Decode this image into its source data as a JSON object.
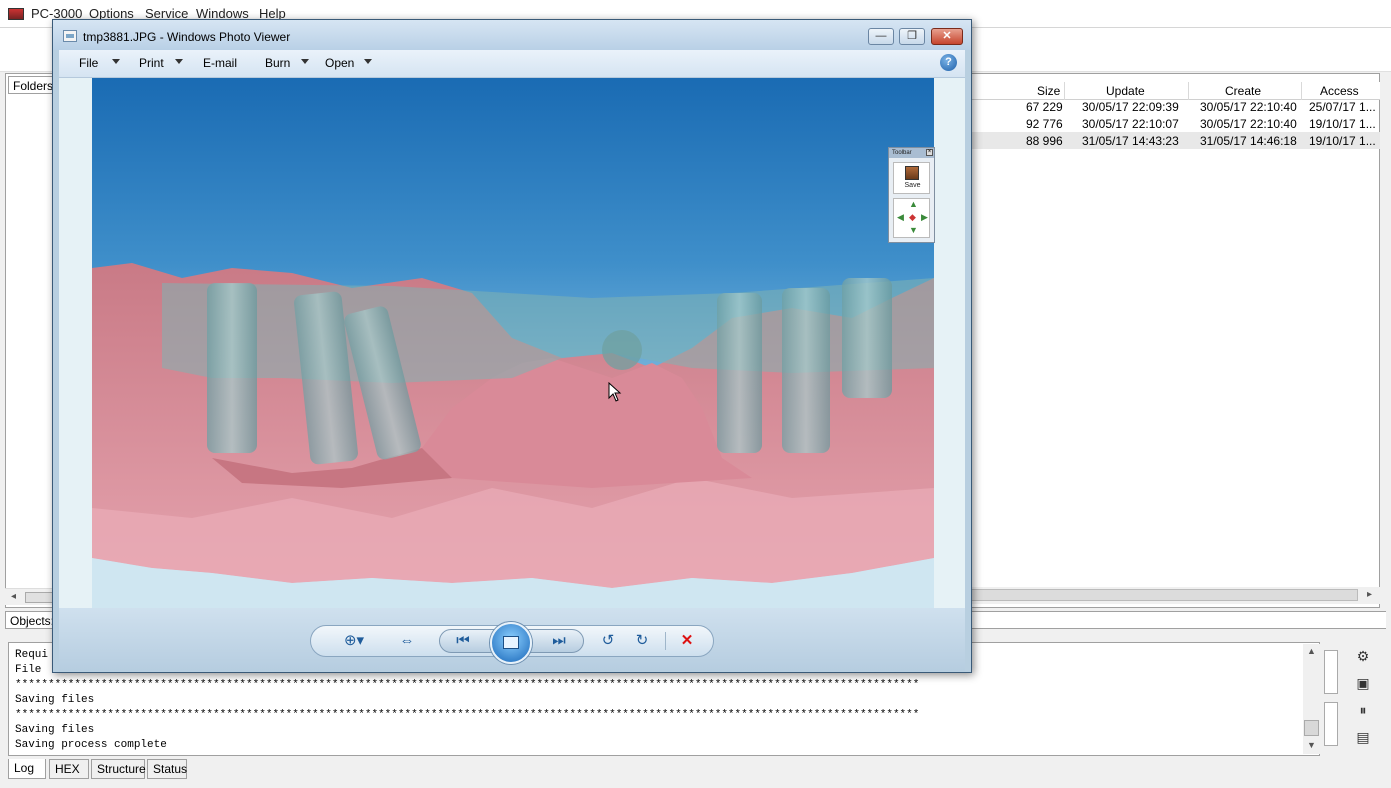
{
  "app": {
    "title": "PC-3000",
    "menu": [
      "PC-3000",
      "Options",
      "Service",
      "Windows",
      "Help"
    ]
  },
  "folders_tab": "Folders",
  "objects_label": "Objects:",
  "files": {
    "headers": {
      "size": "Size",
      "update": "Update",
      "create": "Create",
      "access": "Access"
    },
    "rows": [
      {
        "size": "67 229",
        "update": "30/05/17 22:09:39",
        "create": "30/05/17 22:10:40",
        "access": "25/07/17 1...",
        "selected": false
      },
      {
        "size": "92 776",
        "update": "30/05/17 22:10:07",
        "create": "30/05/17 22:10:40",
        "access": "19/10/17 1...",
        "selected": false
      },
      {
        "size": "88 996",
        "update": "31/05/17 14:43:23",
        "create": "31/05/17 14:46:18",
        "access": "19/10/17 1...",
        "selected": true
      }
    ]
  },
  "log": {
    "lines": [
      "Requi",
      "File ",
      "*****************************************************************************************************************************************",
      "Saving files",
      "*****************************************************************************************************************************************",
      "Saving files",
      "Saving process complete"
    ]
  },
  "bottom_tabs": [
    "Log",
    "HEX",
    "Structure",
    "Status"
  ],
  "photo_viewer": {
    "title": "tmp3881.JPG - Windows Photo Viewer",
    "menu": [
      {
        "label": "File",
        "dropdown": true
      },
      {
        "label": "Print",
        "dropdown": true
      },
      {
        "label": "E-mail",
        "dropdown": false
      },
      {
        "label": "Burn",
        "dropdown": true
      },
      {
        "label": "Open",
        "dropdown": true
      }
    ],
    "help_glyph": "?",
    "window_buttons": {
      "minimize": "—",
      "restore": "❐",
      "close": "✕"
    },
    "mini_toolbar": {
      "title": "Toolbar",
      "save_label": "Save"
    },
    "controls": {
      "zoom": "⊕▾",
      "fit": "⇔",
      "prev": "⏮",
      "next": "⏭",
      "rotate_ccw": "↺",
      "rotate_cw": "↻",
      "delete": "✕"
    }
  },
  "colors": {
    "viewer_chrome": "#b8cfe0",
    "sky_top": "#1a6bb3",
    "gum": "#d98a98",
    "implant": "#7fb3b3"
  }
}
